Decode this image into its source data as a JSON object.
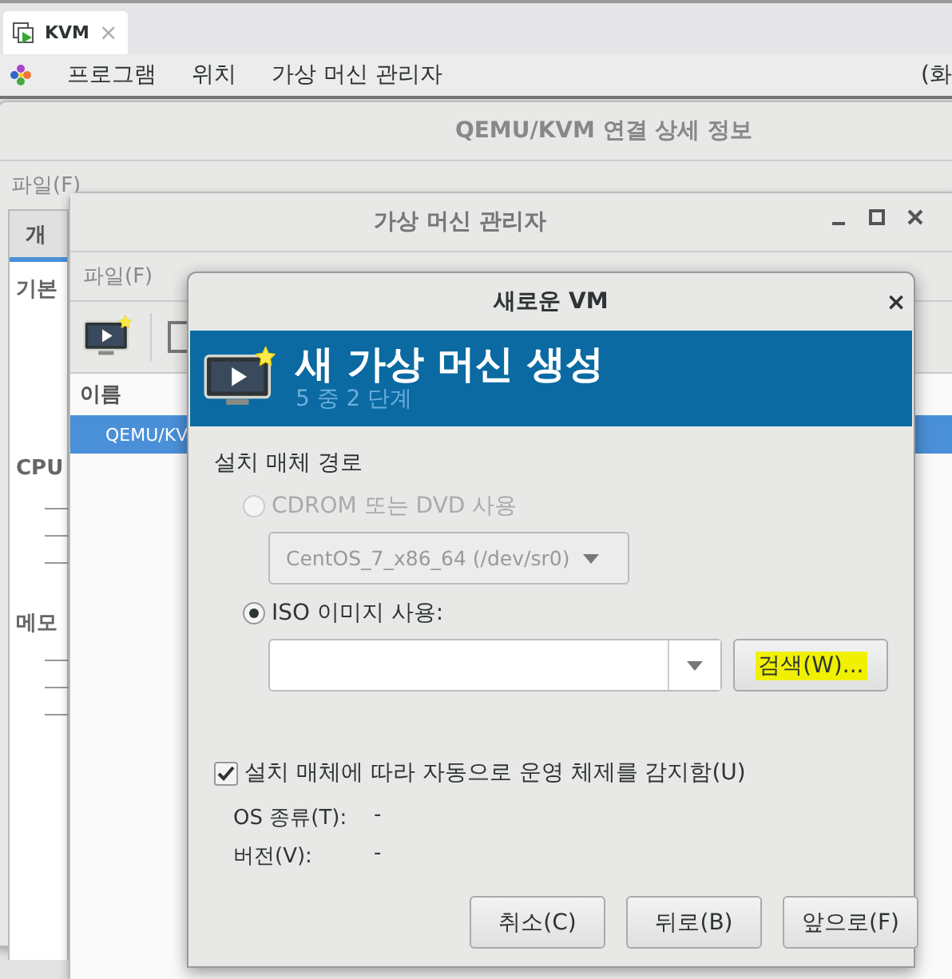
{
  "taskbar_tab": {
    "label": "KVM",
    "close": "×",
    "selected": true
  },
  "top_menu": {
    "items": [
      "프로그램",
      "위치",
      "가상 머신 관리자"
    ],
    "right_text": "(화"
  },
  "details_window": {
    "title": "QEMU/KVM 연결 상세 정보",
    "menu": [
      "파일(F)"
    ],
    "tabs": [
      {
        "label": "개",
        "selected": true
      }
    ],
    "sections": [
      {
        "heading": "기본"
      },
      {
        "heading": "CPU"
      },
      {
        "heading": "메모"
      }
    ]
  },
  "manager_window": {
    "title": "가상 머신 관리자",
    "menu": [
      "파일(F)"
    ],
    "column": "이름",
    "rows": [
      {
        "name": "QEMU/KV",
        "selected": true
      }
    ]
  },
  "dialog": {
    "title": "새로운 VM",
    "close": "×",
    "banner_title": "새 가상 머신 생성",
    "banner_step": "5 중 2 단계",
    "section_label": "설치 매체 경로",
    "options": [
      {
        "kind": "radio",
        "label": "CDROM 또는 DVD 사용",
        "selected": false,
        "disabled": true
      },
      {
        "kind": "combo",
        "value": "CentOS_7_x86_64 (/dev/sr0)",
        "disabled": true
      },
      {
        "kind": "radio",
        "label": "ISO 이미지 사용:",
        "selected": true,
        "disabled": false
      },
      {
        "kind": "entry",
        "button": "검색(W)...",
        "highlighted": true
      }
    ],
    "autodetect": {
      "label": "설치 매체에 따라 자동으로 운영 체제를 감지함(U)",
      "checked": true
    },
    "info": [
      {
        "label": "OS 종류(T):",
        "value": "-"
      },
      {
        "label": "버전(V):",
        "value": "-"
      }
    ],
    "buttons": [
      "취소(C)",
      "뒤로(B)",
      "앞으로(F)"
    ]
  }
}
